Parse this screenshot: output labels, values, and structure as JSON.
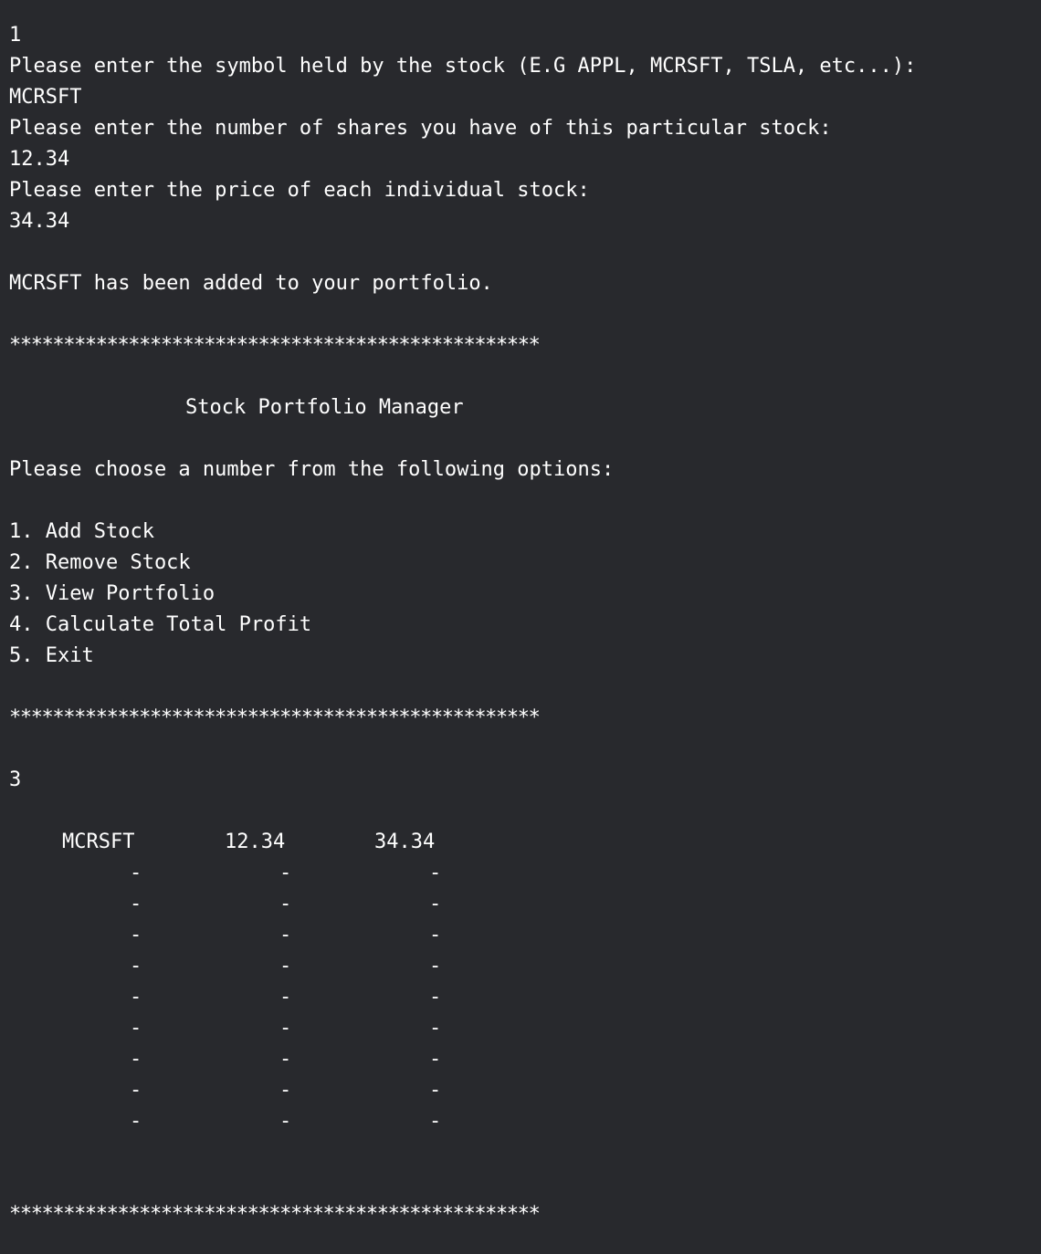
{
  "console": {
    "lines": {
      "input_choice_1": "1",
      "prompt_symbol": "Please enter the symbol held by the stock (E.G APPL, MCRSFT, TSLA, etc...):",
      "input_symbol": "MCRSFT",
      "prompt_shares": "Please enter the number of shares you have of this particular stock:",
      "input_shares": "12.34",
      "prompt_price": "Please enter the price of each individual stock:",
      "input_price": "34.34",
      "added_message": "MCRSFT has been added to your portfolio.",
      "divider": "*************************************************",
      "menu_title": "Stock Portfolio Manager",
      "menu_prompt": "Please choose a number from the following options:",
      "input_choice_3": "3"
    },
    "menu_options": [
      "1. Add Stock",
      "2. Remove Stock",
      "3. View Portfolio",
      "4. Calculate Total Profit",
      "5. Exit"
    ],
    "portfolio": {
      "rows": [
        [
          "MCRSFT",
          "12.34",
          "34.34"
        ],
        [
          "-",
          "-",
          "-"
        ],
        [
          "-",
          "-",
          "-"
        ],
        [
          "-",
          "-",
          "-"
        ],
        [
          "-",
          "-",
          "-"
        ],
        [
          "-",
          "-",
          "-"
        ],
        [
          "-",
          "-",
          "-"
        ],
        [
          "-",
          "-",
          "-"
        ],
        [
          "-",
          "-",
          "-"
        ],
        [
          "-",
          "-",
          "-"
        ]
      ]
    }
  }
}
